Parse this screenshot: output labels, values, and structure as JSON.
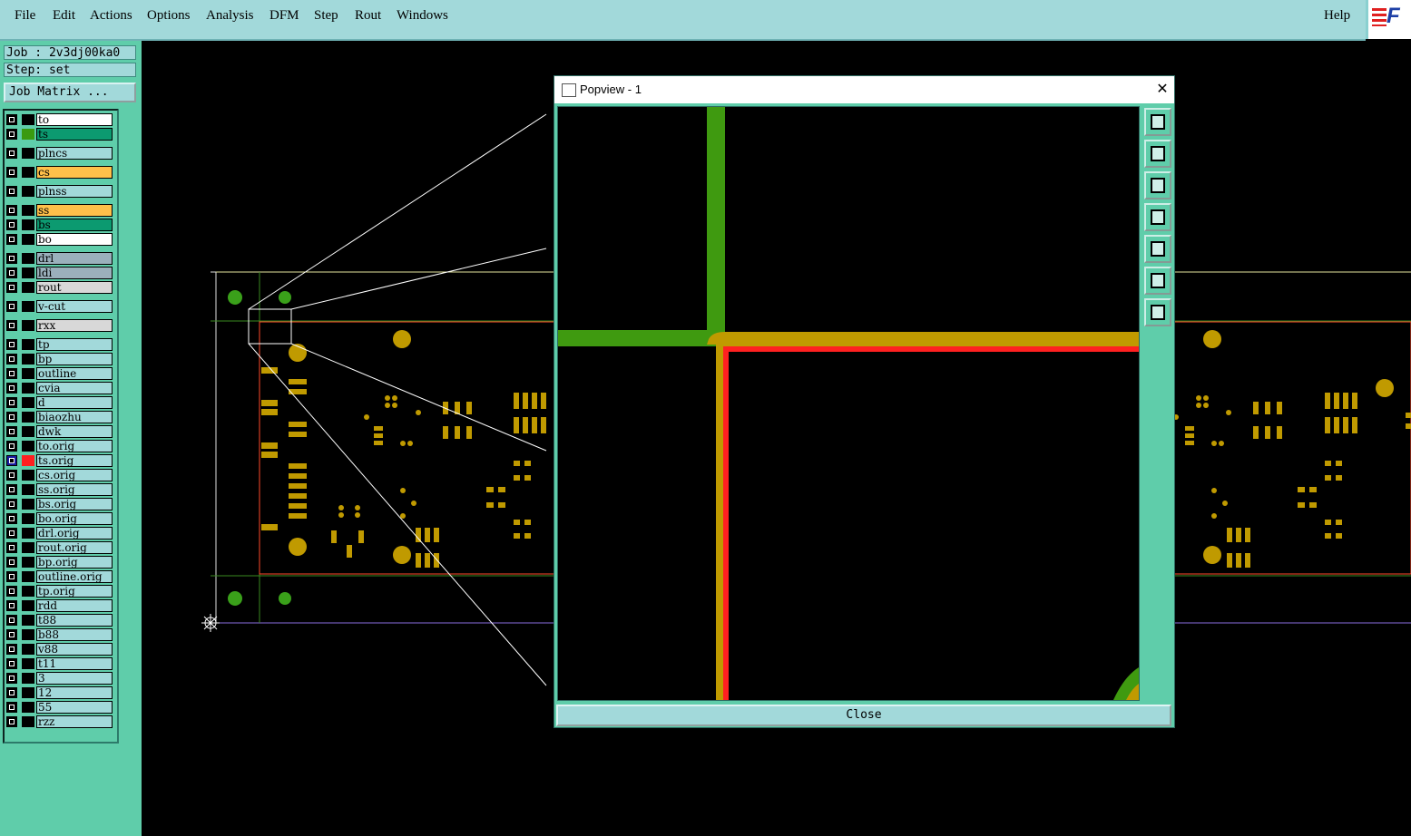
{
  "menu": {
    "items": [
      "File",
      "Edit",
      "Actions",
      "Options",
      "Analysis",
      "DFM",
      "Step",
      "Rout",
      "Windows"
    ],
    "help": "Help",
    "brand": "F"
  },
  "job": {
    "job_label": "Job : 2v3dj00ka0",
    "step_label": "Step: set",
    "matrix_button": "Job Matrix ..."
  },
  "layers": [
    {
      "name": "to",
      "color": "#ffffff",
      "swatch": "#000000"
    },
    {
      "name": "ts",
      "color": "#0c9a70",
      "swatch": "#3a9a10"
    },
    {
      "name": "plncs",
      "color": "#a2d9da",
      "swatch": "#000000"
    },
    {
      "name": "cs",
      "color": "#ffc04a",
      "swatch": "#000000"
    },
    {
      "name": "plnss",
      "color": "#a2d9da",
      "swatch": "#000000"
    },
    {
      "name": "ss",
      "color": "#ffc04a",
      "swatch": "#000000"
    },
    {
      "name": "bs",
      "color": "#0c9a70",
      "swatch": "#000000"
    },
    {
      "name": "bo",
      "color": "#ffffff",
      "swatch": "#000000"
    },
    {
      "name": "drl",
      "color": "#9bb0bc",
      "swatch": "#000000"
    },
    {
      "name": "ldi",
      "color": "#9bb0bc",
      "swatch": "#000000"
    },
    {
      "name": "rout",
      "color": "#d8d8d8",
      "swatch": "#000000"
    },
    {
      "name": "v-cut",
      "color": "#a2d9da",
      "swatch": "#000000"
    },
    {
      "name": "rxx",
      "color": "#d8d8d8",
      "swatch": "#000000"
    },
    {
      "name": "tp",
      "color": "#a2d9da",
      "swatch": "#000000"
    },
    {
      "name": "bp",
      "color": "#a2d9da",
      "swatch": "#000000"
    },
    {
      "name": "outline",
      "color": "#a2d9da",
      "swatch": "#000000"
    },
    {
      "name": "cvia",
      "color": "#a2d9da",
      "swatch": "#000000"
    },
    {
      "name": "d",
      "color": "#a2d9da",
      "swatch": "#000000"
    },
    {
      "name": "biaozhu",
      "color": "#a2d9da",
      "swatch": "#000000"
    },
    {
      "name": "dwk",
      "color": "#a2d9da",
      "swatch": "#000000"
    },
    {
      "name": "to.orig",
      "color": "#a2d9da",
      "swatch": "#000000"
    },
    {
      "name": "ts.orig",
      "color": "#a2d9da",
      "swatch": "#ff2020",
      "active": true
    },
    {
      "name": "cs.orig",
      "color": "#a2d9da",
      "swatch": "#000000"
    },
    {
      "name": "ss.orig",
      "color": "#a2d9da",
      "swatch": "#000000"
    },
    {
      "name": "bs.orig",
      "color": "#a2d9da",
      "swatch": "#000000"
    },
    {
      "name": "bo.orig",
      "color": "#a2d9da",
      "swatch": "#000000"
    },
    {
      "name": "drl.orig",
      "color": "#a2d9da",
      "swatch": "#000000"
    },
    {
      "name": "rout.orig",
      "color": "#a2d9da",
      "swatch": "#000000"
    },
    {
      "name": "bp.orig",
      "color": "#a2d9da",
      "swatch": "#000000"
    },
    {
      "name": "outline.orig",
      "color": "#a2d9da",
      "swatch": "#000000"
    },
    {
      "name": "tp.orig",
      "color": "#a2d9da",
      "swatch": "#000000"
    },
    {
      "name": "rdd",
      "color": "#a2d9da",
      "swatch": "#000000"
    },
    {
      "name": "t88",
      "color": "#a2d9da",
      "swatch": "#000000"
    },
    {
      "name": "b88",
      "color": "#a2d9da",
      "swatch": "#000000"
    },
    {
      "name": "v88",
      "color": "#a2d9da",
      "swatch": "#000000"
    },
    {
      "name": "t11",
      "color": "#a2d9da",
      "swatch": "#000000"
    },
    {
      "name": "3",
      "color": "#a2d9da",
      "swatch": "#000000"
    },
    {
      "name": "12",
      "color": "#a2d9da",
      "swatch": "#000000"
    },
    {
      "name": "55",
      "color": "#a2d9da",
      "swatch": "#000000"
    },
    {
      "name": "rzz",
      "color": "#a2d9da",
      "swatch": "#000000"
    }
  ],
  "popview": {
    "title": "Popview - 1",
    "close_label": "Close",
    "tools": [
      "zoom-window-icon",
      "move-up-icon",
      "move-down-icon",
      "move-left-icon",
      "move-right-icon",
      "zoom-fit-icon",
      "pan-icon"
    ]
  },
  "colors": {
    "panel": "#5fcdaa",
    "menubar": "#a2d9da",
    "copper": "#c09a00",
    "green": "#3f9a10",
    "red": "#ff2020"
  }
}
